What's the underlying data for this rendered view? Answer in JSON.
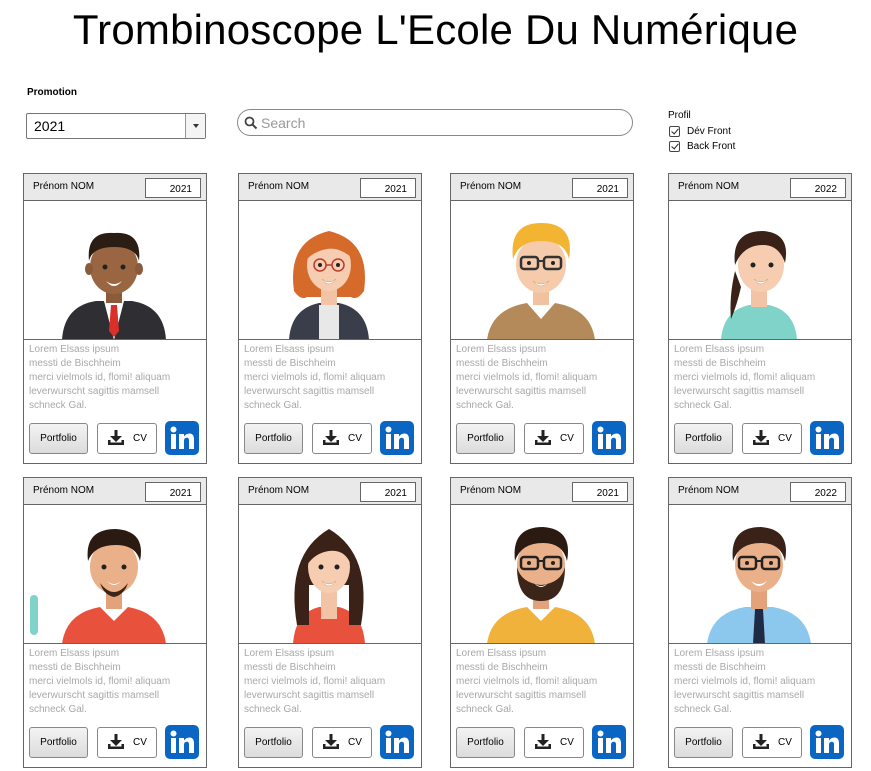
{
  "page": {
    "title": "Trombinoscope L'Ecole Du Numérique"
  },
  "filters": {
    "promotion_label": "Promotion",
    "promotion_value": "2021",
    "search_placeholder": "Search",
    "profil_label": "Profil",
    "profil_options": [
      {
        "label": "Dév Front",
        "checked": true
      },
      {
        "label": "Back Front",
        "checked": true
      }
    ]
  },
  "cards": [
    {
      "name": "Prénom NOM",
      "year": "2021",
      "avatar": "man-dark-suit-icon"
    },
    {
      "name": "Prénom NOM",
      "year": "2021",
      "avatar": "woman-redhead-glasses-icon"
    },
    {
      "name": "Prénom NOM",
      "year": "2021",
      "avatar": "man-blond-glasses-icon"
    },
    {
      "name": "Prénom NOM",
      "year": "2022",
      "avatar": "woman-ponytail-icon"
    },
    {
      "name": "Prénom NOM",
      "year": "2021",
      "avatar": "man-goatee-icon"
    },
    {
      "name": "Prénom NOM",
      "year": "2021",
      "avatar": "woman-long-hair-icon"
    },
    {
      "name": "Prénom NOM",
      "year": "2021",
      "avatar": "man-beard-glasses-icon"
    },
    {
      "name": "Prénom NOM",
      "year": "2022",
      "avatar": "man-tie-glasses-icon"
    }
  ],
  "card_text": {
    "description_lines": [
      "Lorem Elsass ipsum",
      "messti de Bischheim",
      "merci vielmols id, flomi! aliquam",
      "leverwurscht sagittis mamsell",
      "schneck Gal."
    ],
    "portfolio_label": "Portfolio",
    "cv_label": "CV"
  },
  "colors": {
    "linkedin": "#0a66c2",
    "header_bg": "#e9e9e9",
    "desc_text": "#a8a8a8"
  }
}
